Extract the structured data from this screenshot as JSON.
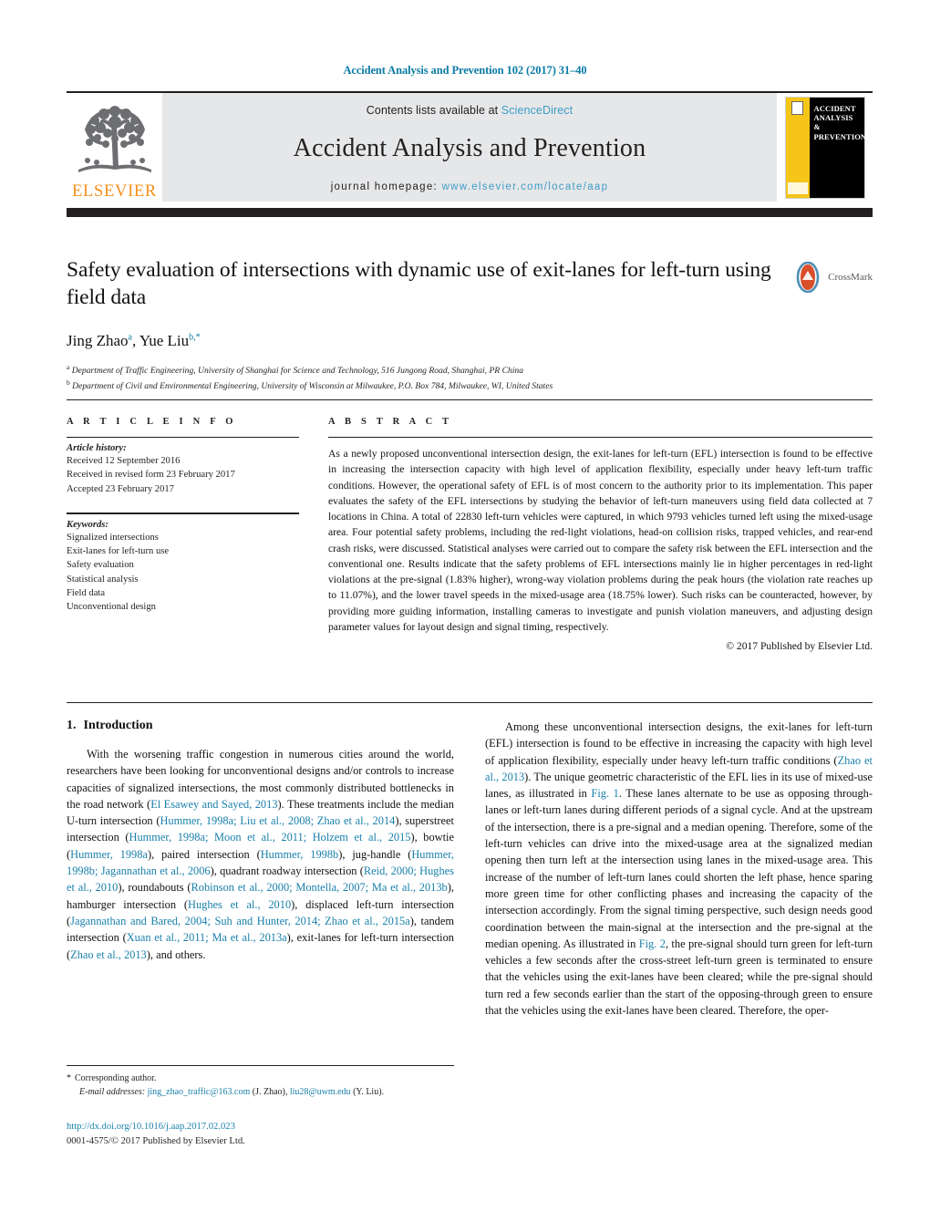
{
  "running_head": "Accident Analysis and Prevention 102 (2017) 31–40",
  "masthead": {
    "publisher_wordmark": "ELSEVIER",
    "contents_prefix": "Contents lists available at ",
    "contents_link": "ScienceDirect",
    "journal_title": "Accident Analysis and Prevention",
    "homepage_prefix": "journal homepage: ",
    "homepage_url": "www.elsevier.com/locate/aap",
    "cover_lines": [
      "ACCIDENT",
      "ANALYSIS",
      "&",
      "PREVENTION"
    ],
    "accent_yellow": "#f5c518",
    "link_blue": "#3e9ec9",
    "elsevier_orange": "#f7901e",
    "bar_black": "#231f20"
  },
  "article": {
    "title": "Safety evaluation of intersections with dynamic use of exit-lanes for left-turn using field data",
    "crossmark_label": "CrossMark",
    "authors": "Jing Zhao",
    "author_a_marker": "a",
    "authors_second": ", Yue Liu",
    "author_b_marker": "b,",
    "affiliations": [
      {
        "marker": "a",
        "text": "Department of Traffic Engineering, University of Shanghai for Science and Technology, 516 Jungong Road, Shanghai, PR China"
      },
      {
        "marker": "b",
        "text": "Department of Civil and Environmental Engineering, University of Wisconsin at Milwaukee, P.O. Box 784, Milwaukee, WI, United States"
      }
    ]
  },
  "article_info": {
    "heading": "A R T I C L E   I N F O",
    "history_label": "Article history:",
    "history": [
      "Received 12 September 2016",
      "Received in revised form 23 February 2017",
      "Accepted 23 February 2017"
    ],
    "keywords_label": "Keywords:",
    "keywords": [
      "Signalized intersections",
      "Exit-lanes for left-turn use",
      "Safety evaluation",
      "Statistical analysis",
      "Field data",
      "Unconventional design"
    ]
  },
  "abstract": {
    "heading": "A B S T R A C T",
    "text": "As a newly proposed unconventional intersection design, the exit-lanes for left-turn (EFL) intersection is found to be effective in increasing the intersection capacity with high level of application flexibility, especially under heavy left-turn traffic conditions. However, the operational safety of EFL is of most concern to the authority prior to its implementation. This paper evaluates the safety of the EFL intersections by studying the behavior of left-turn maneuvers using field data collected at 7 locations in China. A total of 22830 left-turn vehicles were captured, in which 9793 vehicles turned left using the mixed-usage area. Four potential safety problems, including the red-light violations, head-on collision risks, trapped vehicles, and rear-end crash risks, were discussed. Statistical analyses were carried out to compare the safety risk between the EFL intersection and the conventional one. Results indicate that the safety problems of EFL intersections mainly lie in higher percentages in red-light violations at the pre-signal (1.83% higher), wrong-way violation problems during the peak hours (the violation rate reaches up to 11.07%), and the lower travel speeds in the mixed-usage area (18.75% lower). Such risks can be counteracted, however, by providing more guiding information, installing cameras to investigate and punish violation maneuvers, and adjusting design parameter values for layout design and signal timing, respectively.",
    "copyright": "© 2017 Published by Elsevier Ltd."
  },
  "introduction": {
    "heading_number": "1.",
    "heading_text": "Introduction",
    "left_paragraph_html": "With the worsening traffic congestion in numerous cities around the world, researchers have been looking for unconventional designs and/or controls to increase capacities of signalized intersections, the most commonly distributed bottlenecks in the road network (<span class=\"ref\">El Esawey and Sayed, 2013</span>). These treatments include the median U-turn intersection (<span class=\"ref\">Hummer, 1998a; Liu et al., 2008; Zhao et al., 2014</span>), superstreet intersection (<span class=\"ref\">Hummer, 1998a; Moon et al., 2011; Holzem et al., 2015</span>), bowtie (<span class=\"ref\">Hummer, 1998a</span>), paired intersection (<span class=\"ref\">Hummer, 1998b</span>), jug-handle (<span class=\"ref\">Hummer, 1998b; Jagannathan et al., 2006</span>), quadrant roadway intersection (<span class=\"ref\">Reid, 2000; Hughes et al., 2010</span>), roundabouts (<span class=\"ref\">Robinson et al., 2000; Montella, 2007; Ma et al., 2013b</span>), hamburger intersection (<span class=\"ref\">Hughes et al., 2010</span>), displaced left-turn intersection (<span class=\"ref\">Jagannathan and Bared, 2004; Suh and Hunter, 2014; Zhao et al., 2015a</span>), tandem intersection (<span class=\"ref\">Xuan et al., 2011; Ma et al., 2013a</span>), exit-lanes for left-turn intersection (<span class=\"ref\">Zhao et al., 2013</span>), and others.",
    "right_paragraph_html": "Among these unconventional intersection designs, the exit-lanes for left-turn (EFL) intersection is found to be effective in increasing the capacity with high level of application flexibility, especially under heavy left-turn traffic conditions (<span class=\"ref\">Zhao et al., 2013</span>). The unique geometric characteristic of the EFL lies in its use of mixed-use lanes, as illustrated in <span class=\"ref\">Fig. 1</span>. These lanes alternate to be use as opposing through-lanes or left-turn lanes during different periods of a signal cycle. And at the upstream of the intersection, there is a pre-signal and a median opening. Therefore, some of the left-turn vehicles can drive into the mixed-usage area at the signalized median opening then turn left at the intersection using lanes in the mixed-usage area. This increase of the number of left-turn lanes could shorten the left phase, hence sparing more green time for other conflicting phases and increasing the capacity of the intersection accordingly. From the signal timing perspective, such design needs good coordination between the main-signal at the intersection and the pre-signal at the median opening. As illustrated in <span class=\"ref\">Fig. 2</span>, the pre-signal should turn green for left-turn vehicles a few seconds after the cross-street left-turn green is terminated to ensure that the vehicles using the exit-lanes have been cleared; while the pre-signal should turn red a few seconds earlier than the start of the opposing-through green to ensure that the vehicles using the exit-lanes have been cleared. Therefore, the oper-"
  },
  "footnote": {
    "star": "*",
    "corresponding": "Corresponding author.",
    "emails_label": "E-mail addresses:",
    "email_1": "jing_zhao_traffic@163.com",
    "email_1_owner": "(J. Zhao),",
    "email_2": "liu28@uwm.edu",
    "email_2_owner": "(Y. Liu)."
  },
  "doi_block": {
    "doi": "http://dx.doi.org/10.1016/j.aap.2017.02.023",
    "issn_line": "0001-4575/© 2017 Published by Elsevier Ltd."
  }
}
